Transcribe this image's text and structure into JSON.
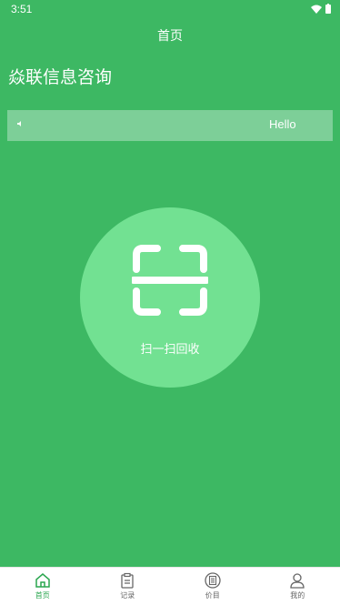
{
  "status": {
    "time": "3:51"
  },
  "header": {
    "title": "首页"
  },
  "company": {
    "name": "焱联信息咨询"
  },
  "notice": {
    "icon": "speaker-icon",
    "text": "Hello"
  },
  "scan": {
    "label": "扫一扫回收"
  },
  "nav": {
    "items": [
      {
        "label": "首页",
        "icon": "home-icon",
        "active": true
      },
      {
        "label": "记录",
        "icon": "clipboard-icon",
        "active": false
      },
      {
        "label": "价目",
        "icon": "list-circle-icon",
        "active": false
      },
      {
        "label": "我的",
        "icon": "user-icon",
        "active": false
      }
    ]
  },
  "colors": {
    "primary": "#3db863",
    "circle": "#72e192",
    "active": "#2aa64f"
  }
}
